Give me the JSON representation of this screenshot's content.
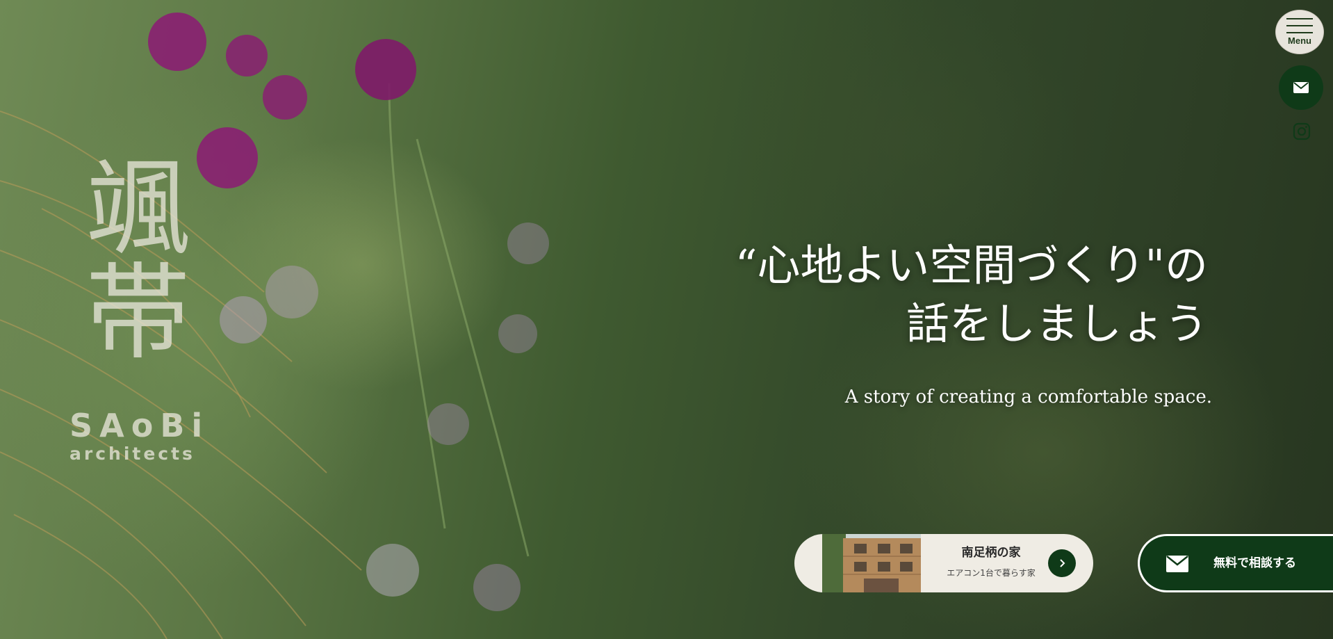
{
  "hero": {
    "headline_line1": "“心地よい空間づくり\"の",
    "headline_line2": "話をしましょう",
    "subheadline": "A story of creating a comfortable space."
  },
  "logo": {
    "kanji": "颯帯",
    "word": "SAoBi",
    "sub": "architects"
  },
  "nav": {
    "menu_label": "Menu",
    "mail_icon": "envelope-icon",
    "instagram_icon": "instagram-icon"
  },
  "project_card": {
    "title": "南足柄の家",
    "subtitle": "エアコン1台で暮らす家",
    "arrow_icon": "chevron-right-icon"
  },
  "consult": {
    "label": "無料で相談する",
    "icon": "envelope-icon"
  },
  "colors": {
    "brand_green": "#0f3a18",
    "menu_bg": "#e7e4dc",
    "card_bg": "#efece4"
  }
}
